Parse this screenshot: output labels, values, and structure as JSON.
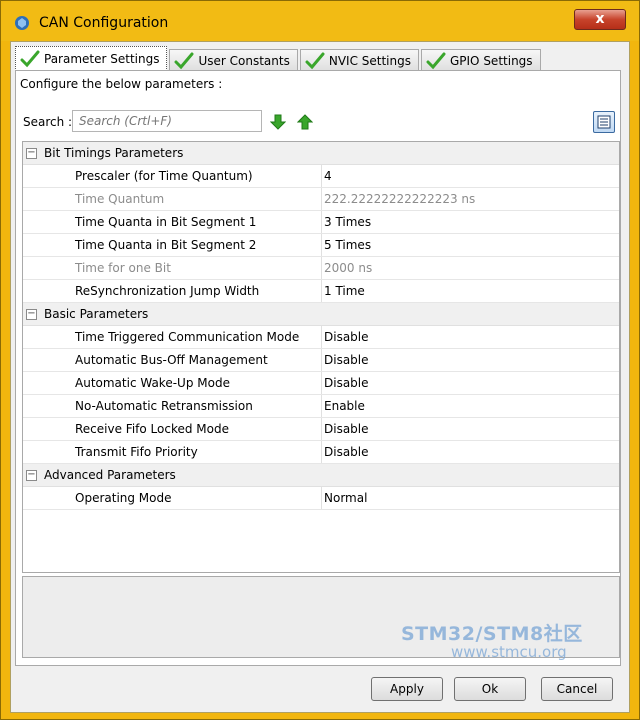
{
  "window": {
    "title": "CAN Configuration",
    "close_label": "x"
  },
  "tabs": [
    {
      "label": "Parameter Settings",
      "active": true
    },
    {
      "label": "User Constants",
      "active": false
    },
    {
      "label": "NVIC Settings",
      "active": false
    },
    {
      "label": "GPIO Settings",
      "active": false
    }
  ],
  "intro": "Configure the below parameters :",
  "search": {
    "label": "Search :",
    "placeholder": "Search (Crtl+F)"
  },
  "groups": [
    {
      "label": "Bit Timings Parameters",
      "rows": [
        {
          "name": "Prescaler (for Time Quantum)",
          "value": "4",
          "readonly": false
        },
        {
          "name": "Time Quantum",
          "value": "222.22222222222223 ns",
          "readonly": true
        },
        {
          "name": "Time Quanta in Bit Segment 1",
          "value": "3 Times",
          "readonly": false
        },
        {
          "name": "Time Quanta in Bit Segment 2",
          "value": "5 Times",
          "readonly": false
        },
        {
          "name": "Time for one Bit",
          "value": "2000 ns",
          "readonly": true
        },
        {
          "name": "ReSynchronization Jump Width",
          "value": "1 Time",
          "readonly": false
        }
      ]
    },
    {
      "label": "Basic Parameters",
      "rows": [
        {
          "name": "Time Triggered Communication Mode",
          "value": "Disable",
          "readonly": false
        },
        {
          "name": "Automatic Bus-Off Management",
          "value": "Disable",
          "readonly": false
        },
        {
          "name": "Automatic Wake-Up Mode",
          "value": "Disable",
          "readonly": false
        },
        {
          "name": "No-Automatic Retransmission",
          "value": "Enable",
          "readonly": false
        },
        {
          "name": "Receive Fifo Locked Mode",
          "value": "Disable",
          "readonly": false
        },
        {
          "name": "Transmit Fifo Priority",
          "value": "Disable",
          "readonly": false
        }
      ]
    },
    {
      "label": "Advanced Parameters",
      "rows": [
        {
          "name": "Operating Mode",
          "value": "Normal",
          "readonly": false
        }
      ]
    }
  ],
  "buttons": {
    "apply": "Apply",
    "ok": "Ok",
    "cancel": "Cancel"
  },
  "watermark": {
    "line1": "STM32/STM8社区",
    "line2": "www.stmcu.org"
  },
  "colors": {
    "frame": "#f2b60e",
    "check": "#3aa62c",
    "arrow": "#3aa62c",
    "readonly_text": "#8c8c8c"
  },
  "icons": {
    "tab_status": "check-icon",
    "search_next": "arrow-down-icon",
    "search_prev": "arrow-up-icon",
    "view": "list-view-icon"
  }
}
